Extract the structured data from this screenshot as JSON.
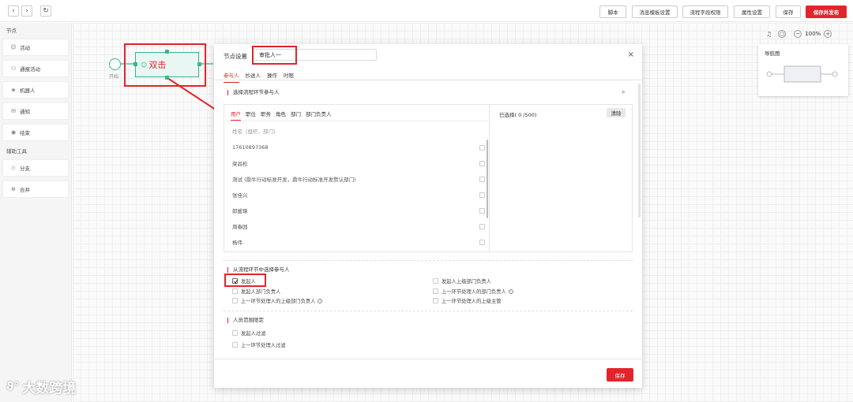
{
  "toolbar": {
    "back_icon": "chevron-left-icon",
    "forward_icon": "chevron-right-icon",
    "refresh_icon": "refresh-icon",
    "buttons": [
      "脚本",
      "消息模板设置",
      "流程字段权限",
      "属性设置",
      "保存"
    ],
    "publish_label": "保存并发布",
    "accent_color": "#e4242c"
  },
  "sidebar": {
    "nodes_title": "节点",
    "nodes": [
      {
        "icon": "person-icon",
        "label": "活动"
      },
      {
        "icon": "group-icon",
        "label": "通报活动"
      },
      {
        "icon": "robot-icon",
        "label": "机器人"
      },
      {
        "icon": "mail-icon",
        "label": "通知"
      },
      {
        "icon": "end-icon",
        "label": "结束"
      }
    ],
    "tools_title": "辅助工具",
    "tools": [
      {
        "icon": "branch-icon",
        "label": "分支"
      },
      {
        "icon": "merge-icon",
        "label": "合并"
      }
    ]
  },
  "canvas": {
    "start_label": "开始",
    "task_annotation": "双击",
    "zoom": "100%",
    "navigator_title": "导航图"
  },
  "modal": {
    "title": "节点设置",
    "node_name": "审批人一",
    "tabs": [
      "参与人",
      "抄送人",
      "操作",
      "时限"
    ],
    "active_tab": "参与人",
    "select_section_title": "选择流程环节参与人",
    "picker_tabs": [
      "用户",
      "职位",
      "职务",
      "角色",
      "部门",
      "部门负责人"
    ],
    "search_placeholder": "姓名（组织，部门）",
    "users": [
      "17610897368",
      "梁昌松",
      "测试 (鼎牛行动标准开发，鼎牛行动标准开发默认部门)",
      "张佳兴",
      "郎媛琢",
      "周春园",
      "杨伟"
    ],
    "selected_label": "已选择( 0 /500)",
    "clear_label": "清除",
    "from_section_title": "从流程环节中选择参与人",
    "from_options_left": [
      "发起人",
      "发起人部门负责人",
      "上一环节处理人的上级部门负责人"
    ],
    "from_options_right": [
      "发起人上级部门负责人",
      "上一环节处理人的部门负责人",
      "上一环节处理人的上级主管"
    ],
    "checked_option": "发起人",
    "range_section_title": "人员范围限定",
    "range_options": [
      "发起人过滤",
      "上一环节处理人过滤"
    ],
    "save_label": "保存"
  },
  "watermark": "大数跨境"
}
